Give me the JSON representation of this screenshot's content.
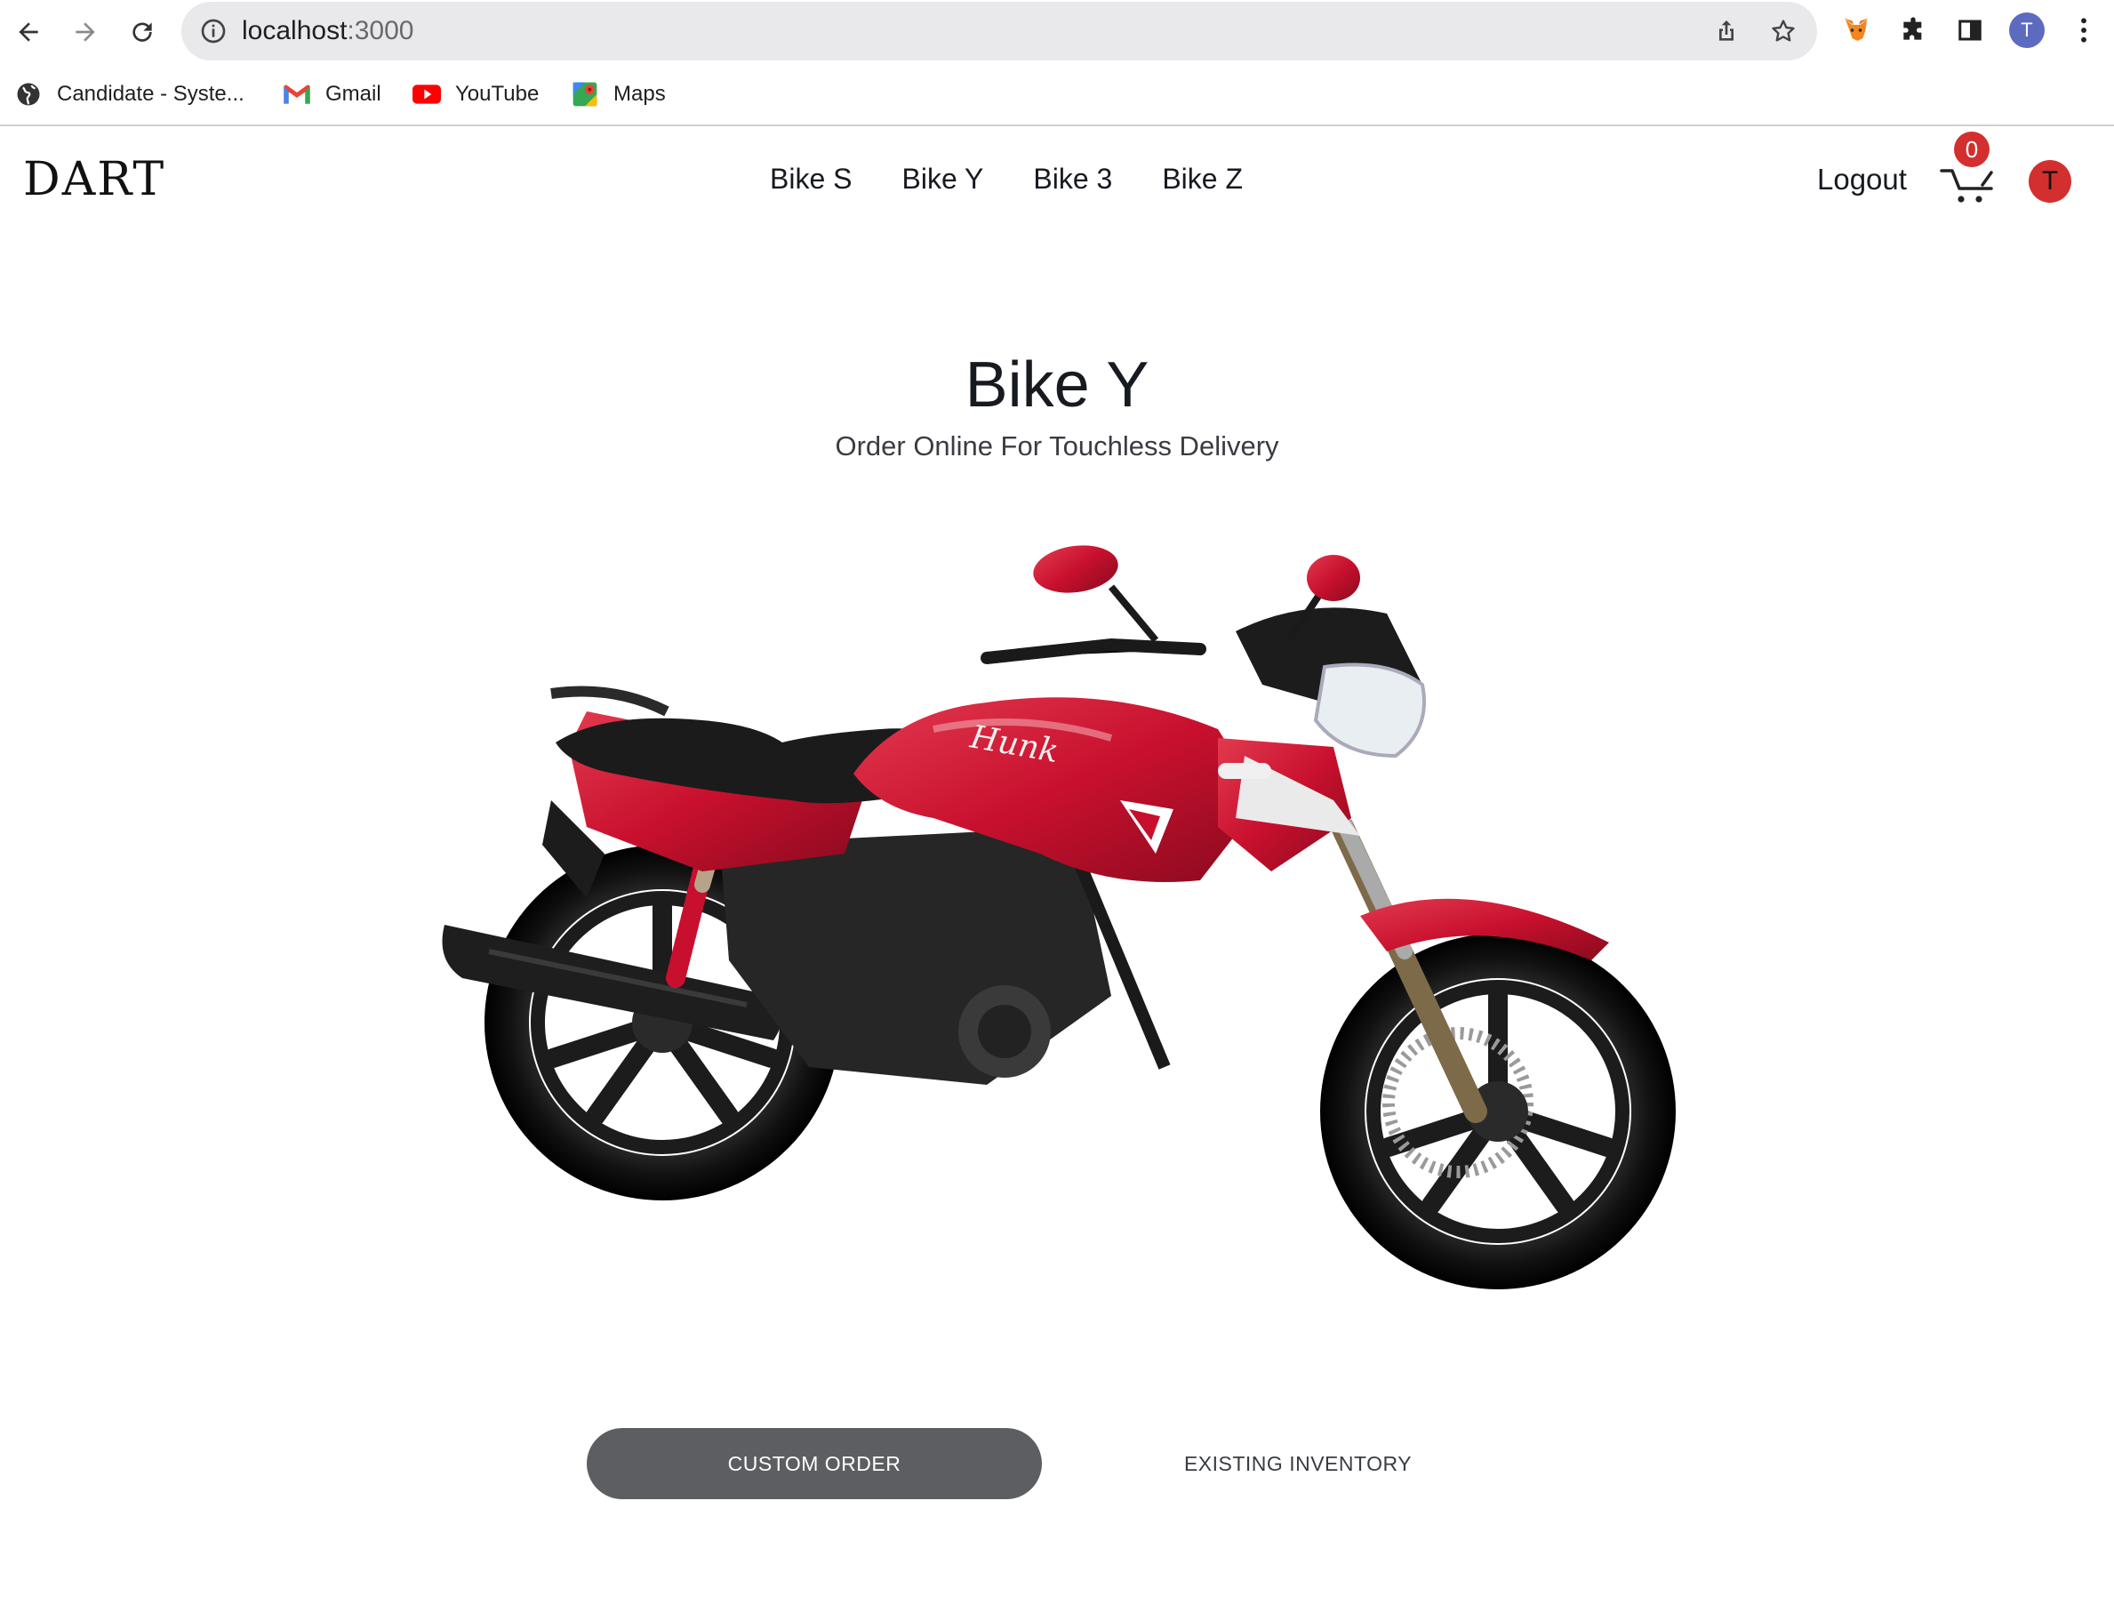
{
  "browser": {
    "url_host": "localhost",
    "url_port": ":3000",
    "profile_initial": "T",
    "bookmarks": [
      {
        "label": "Candidate - Syste...",
        "icon": "globe-icon"
      },
      {
        "label": "Gmail",
        "icon": "gmail-icon"
      },
      {
        "label": "YouTube",
        "icon": "youtube-icon"
      },
      {
        "label": "Maps",
        "icon": "maps-icon"
      }
    ]
  },
  "site": {
    "logo": "DART",
    "nav": [
      "Bike S",
      "Bike Y",
      "Bike 3",
      "Bike Z"
    ],
    "logout_label": "Logout",
    "cart_count": "0",
    "user_initial": "T"
  },
  "hero": {
    "title": "Bike Y",
    "subtitle": "Order Online For Touchless Delivery",
    "primary_button": "CUSTOM ORDER",
    "secondary_button": "EXISTING INVENTORY"
  },
  "colors": {
    "accent_red": "#d32f2f",
    "button_gray": "#5c5e62",
    "bike_red": "#c8102e"
  }
}
